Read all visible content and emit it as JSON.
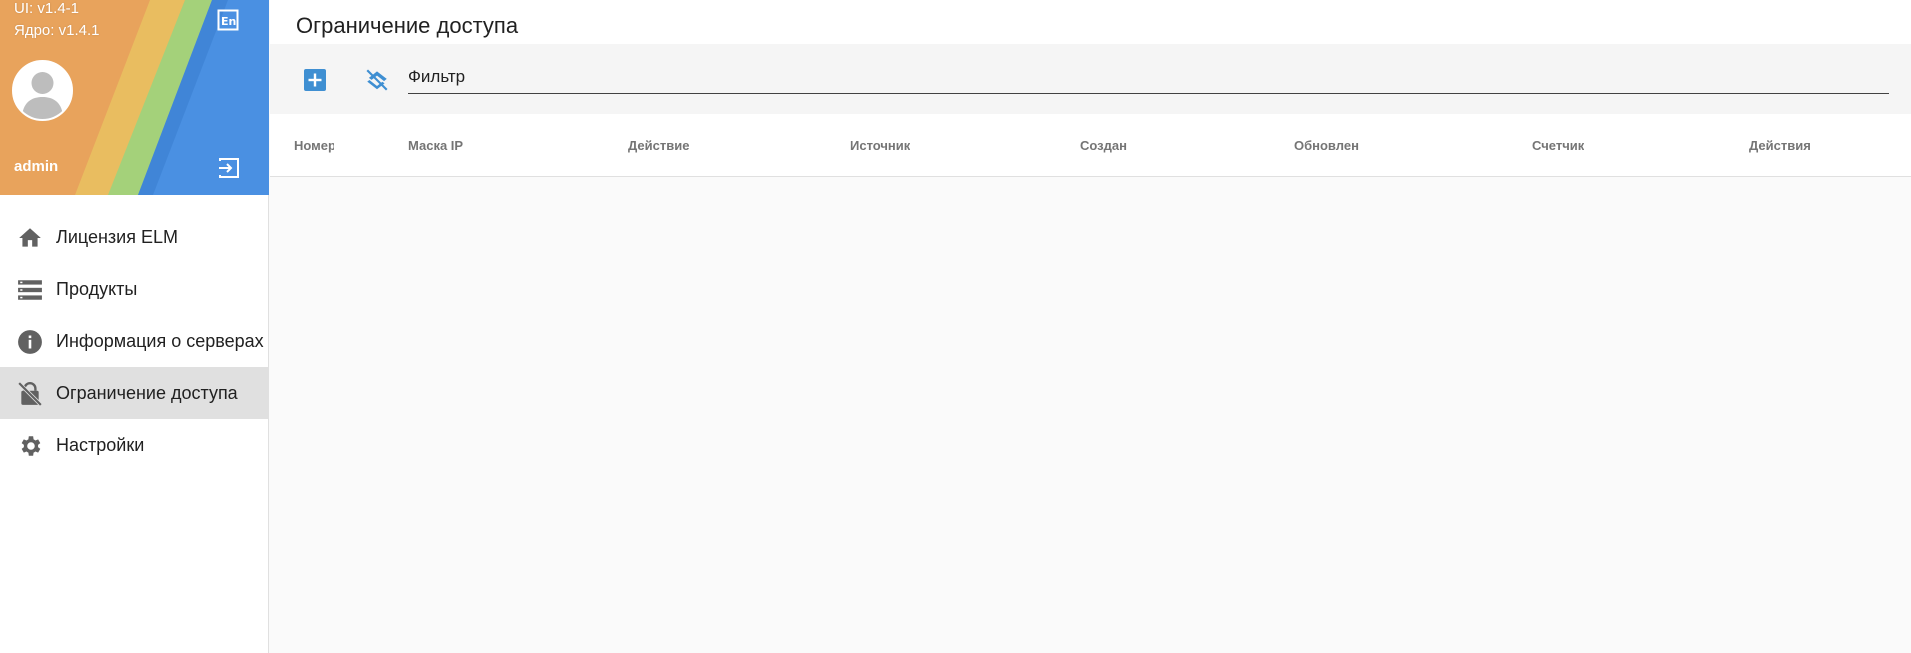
{
  "sidebar": {
    "version_ui": "UI: v1.4-1",
    "version_core": "Ядро: v1.4.1",
    "username": "admin",
    "header_colors": [
      "#e8a35c",
      "#e9bd60",
      "#a4d17a",
      "#4a90e2"
    ],
    "items": [
      {
        "label": "Лицензия ELM",
        "icon": "home-icon"
      },
      {
        "label": "Продукты",
        "icon": "list-icon"
      },
      {
        "label": "Информация о серверах",
        "icon": "info-icon"
      },
      {
        "label": "Ограничение доступа",
        "icon": "lock-off-icon",
        "active": true
      },
      {
        "label": "Настройки",
        "icon": "gear-icon"
      }
    ]
  },
  "main": {
    "title": "Ограничение доступа",
    "filter_placeholder": "Фильтр",
    "filter_value": "",
    "accent_color": "#3f8fd2",
    "columns": [
      "Номер",
      "Маска IP",
      "Действие",
      "Источник",
      "Создан",
      "Обновлен",
      "Счетчик",
      "Действия"
    ],
    "rows": []
  }
}
